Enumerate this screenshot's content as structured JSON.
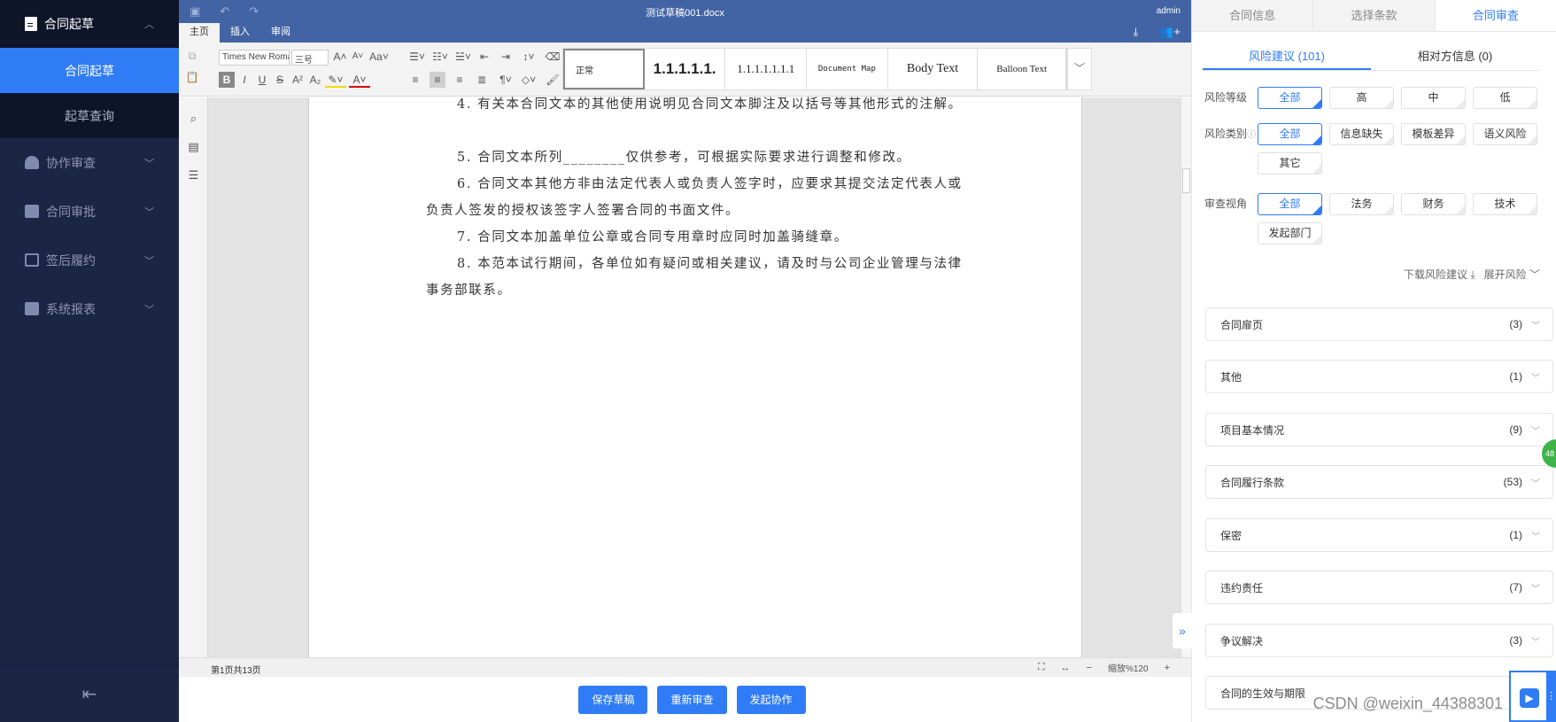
{
  "sidebar": {
    "group_open": {
      "label": "合同起草",
      "icon": "document-icon"
    },
    "subitems": [
      {
        "label": "合同起草",
        "active": true
      },
      {
        "label": "起草查询",
        "active": false
      }
    ],
    "items": [
      {
        "label": "协作审查",
        "icon": "users-icon"
      },
      {
        "label": "合同审批",
        "icon": "clipboard-check-icon"
      },
      {
        "label": "签后履约",
        "icon": "contract-icon"
      },
      {
        "label": "系统报表",
        "icon": "chart-icon"
      }
    ],
    "collapse_icon": "menu-collapse-icon"
  },
  "editor": {
    "filename": "测试草稿001.docx",
    "user": "admin",
    "tabs": [
      {
        "label": "主页",
        "active": true
      },
      {
        "label": "插入",
        "active": false
      },
      {
        "label": "审阅",
        "active": false
      }
    ],
    "font_name": "Times New Roman",
    "font_size": "三号",
    "styles": [
      "正常",
      "1.1.1.1.1.",
      "1.1.1.1.1.1.1",
      "Document Map",
      "Body Text",
      "Balloon Text"
    ],
    "document": {
      "paragraphs": [
        "4.  有关本合同文本的其他使用说明见合同文本脚注及以括号等其他形式的注解。",
        "5. 合同文本所列________仅供参考，可根据实际要求进行调整和修改。",
        "6.  合同文本其他方非由法定代表人或负责人签字时，应要求其提交法定代表人或负责人签发的授权该签字人签署合同的书面文件。",
        "7. 合同文本加盖单位公章或合同专用章时应同时加盖骑缝章。",
        "8.  本范本试行期间，各单位如有疑问或相关建议，请及时与公司企业管理与法律事务部联系。"
      ]
    },
    "status": {
      "page_info": "第1页共13页",
      "zoom_label": "缩放%120"
    },
    "actions": {
      "save_draft": "保存草稿",
      "re_review": "重新审查",
      "start_collab": "发起协作"
    }
  },
  "panel": {
    "top_tabs": [
      {
        "label": "合同信息",
        "active": false
      },
      {
        "label": "选择条款",
        "active": false
      },
      {
        "label": "合同审查",
        "active": true
      }
    ],
    "sub_tabs": [
      {
        "label": "风险建议 (101)",
        "active": true
      },
      {
        "label": "相对方信息 (0)",
        "active": false
      }
    ],
    "filters": [
      {
        "label": "风险等级",
        "options": [
          "全部",
          "高",
          "中",
          "低"
        ],
        "selected": "全部"
      },
      {
        "label": "风险类别",
        "options": [
          "全部",
          "信息缺失",
          "模板差异",
          "语义风险",
          "其它"
        ],
        "selected": "全部"
      },
      {
        "label": "审查视角",
        "options": [
          "全部",
          "法务",
          "财务",
          "技术",
          "发起部门"
        ],
        "selected": "全部"
      }
    ],
    "download_label": "下载风险建议",
    "expand_label": "展开风险",
    "sections": [
      {
        "name": "合同扉页",
        "count": "(3)"
      },
      {
        "name": "其他",
        "count": "(1)"
      },
      {
        "name": "项目基本情况",
        "count": "(9)"
      },
      {
        "name": "合同履行条款",
        "count": "(53)"
      },
      {
        "name": "保密",
        "count": "(1)"
      },
      {
        "name": "违约责任",
        "count": "(7)"
      },
      {
        "name": "争议解决",
        "count": "(3)"
      },
      {
        "name": "合同的生效与期限",
        "count": ""
      }
    ],
    "floating_badge": "48",
    "accent_color": "#2f7cf6"
  },
  "watermark": "CSDN @weixin_44388301"
}
